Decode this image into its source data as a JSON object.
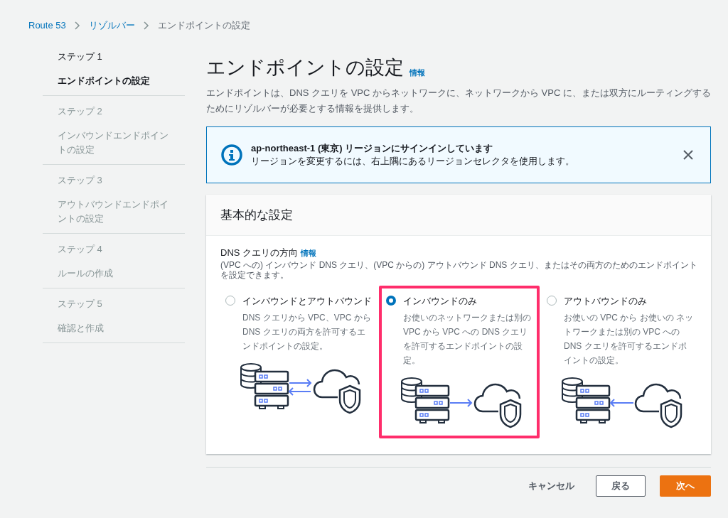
{
  "breadcrumbs": [
    {
      "label": "Route 53",
      "link": true
    },
    {
      "label": "リゾルバー",
      "link": true
    },
    {
      "label": "エンドポイントの設定",
      "link": false
    }
  ],
  "steps": [
    {
      "step": "ステップ 1",
      "title": "エンドポイントの設定",
      "selected": true
    },
    {
      "step": "ステップ 2",
      "title": "インバウンドエンドポイントの設定",
      "selected": false
    },
    {
      "step": "ステップ 3",
      "title": "アウトバウンドエンドポイントの設定",
      "selected": false
    },
    {
      "step": "ステップ 4",
      "title": "ルールの作成",
      "selected": false
    },
    {
      "step": "ステップ 5",
      "title": "確認と作成",
      "selected": false
    }
  ],
  "page": {
    "title": "エンドポイントの設定",
    "info_link": "情報",
    "description": "エンドポイントは、DNS クエリを VPC からネットワークに、ネットワークから VPC に、または双方にルーティングするためにリゾルバーが必要とする情報を提供します。"
  },
  "alert": {
    "title": "ap-northeast-1 (東京) リージョンにサインインしています",
    "message": "リージョンを変更するには、右上隅にあるリージョンセレクタを使用します。"
  },
  "panel": {
    "title": "基本的な設定",
    "field_label": "DNS クエリの方向",
    "field_info": "情報",
    "field_description": "(VPC への) インバウンド DNS クエリ、(VPC からの) アウトバウンド DNS クエリ、またはその両方のためのエンドポイントを設定できます。",
    "options": [
      {
        "kind": "both",
        "label": "インバウンドとアウトバウンド",
        "description": "DNS クエリから VPC、VPC から DNS クエリの両方を許可するエンドポイントの設定。",
        "selected": false,
        "highlighted": false
      },
      {
        "kind": "inbound",
        "label": "インバウンドのみ",
        "description": "お使いのネットワークまたは別の VPC から VPC への DNS クエリを許可するエンドポイントの設定。",
        "selected": true,
        "highlighted": true
      },
      {
        "kind": "outbound",
        "label": "アウトバウンドのみ",
        "description": "お使いの VPC から お使いの ネットワークまたは別の VPC への DNS クエリを許可するエンドポイントの設定。",
        "selected": false,
        "highlighted": false
      }
    ]
  },
  "footer": {
    "cancel": "キャンセル",
    "back": "戻る",
    "next": "次へ"
  }
}
